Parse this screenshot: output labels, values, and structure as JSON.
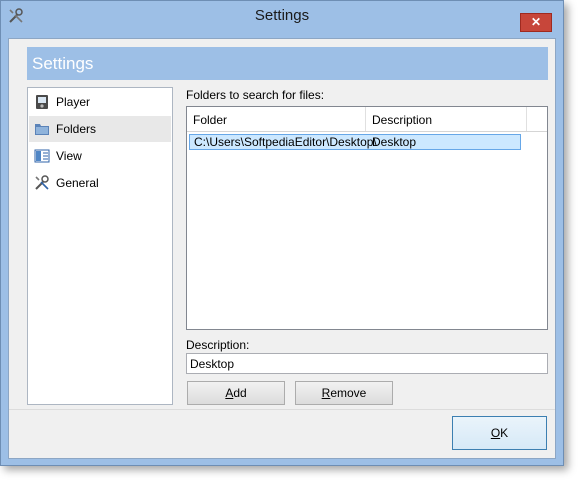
{
  "window": {
    "title": "Settings",
    "close_label": "✕"
  },
  "banner": {
    "title": "Settings"
  },
  "sidebar": {
    "items": [
      {
        "label": "Player",
        "icon": "player-icon"
      },
      {
        "label": "Folders",
        "icon": "folder-icon",
        "selected": true
      },
      {
        "label": "View",
        "icon": "view-icon"
      },
      {
        "label": "General",
        "icon": "tools-icon"
      }
    ]
  },
  "folders": {
    "section_label": "Folders to search for files:",
    "columns": [
      "Folder",
      "Description"
    ],
    "rows": [
      {
        "folder": "C:\\Users\\SoftpediaEditor\\Desktop\\",
        "description": "Desktop"
      }
    ]
  },
  "description": {
    "label": "Description:",
    "value": "Desktop"
  },
  "buttons": {
    "add_prefix": "A",
    "add_rest": "dd",
    "remove_prefix": "R",
    "remove_rest": "emove",
    "ok_prefix": "O",
    "ok_rest": "K"
  }
}
